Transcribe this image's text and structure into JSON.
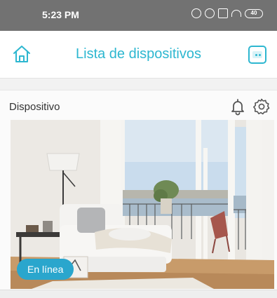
{
  "status_bar": {
    "time": "5:23 PM",
    "battery": "40"
  },
  "header": {
    "title": "Lista de dispositivos",
    "home_icon": "home-icon",
    "menu_icon": "device-menu-icon"
  },
  "device": {
    "name": "Dispositivo",
    "status": "En línea",
    "notification_icon": "bell-icon",
    "settings_icon": "gear-icon"
  },
  "colors": {
    "accent": "#2db7d0",
    "status_pill": "#2aa6cd",
    "status_bar": "#727272"
  }
}
